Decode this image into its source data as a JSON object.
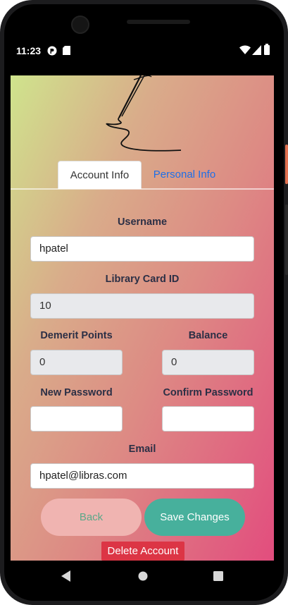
{
  "status_bar": {
    "time": "11:23",
    "icons": [
      "app-notification-icon",
      "sd-card-icon",
      "wifi-icon",
      "signal-icon",
      "battery-icon"
    ]
  },
  "tabs": {
    "active": "Account Info",
    "inactive": "Personal Info"
  },
  "form": {
    "username_label": "Username",
    "username_value": "hpatel",
    "library_card_label": "Library Card ID",
    "library_card_value": "10",
    "demerit_label": "Demerit Points",
    "demerit_value": "0",
    "balance_label": "Balance",
    "balance_value": "0",
    "new_password_label": "New Password",
    "new_password_value": "",
    "confirm_password_label": "Confirm Password",
    "confirm_password_value": "",
    "email_label": "Email",
    "email_value": "hpatel@libras.com"
  },
  "buttons": {
    "back": "Back",
    "save": "Save Changes",
    "delete": "Delete Account"
  },
  "colors": {
    "gradient_start": "#cfe48c",
    "gradient_end": "#e24d7e",
    "tab_inactive": "#1d6fe8",
    "back_button": "#f0b4b1",
    "save_button": "#47b09c",
    "delete_button": "#dc3545"
  }
}
